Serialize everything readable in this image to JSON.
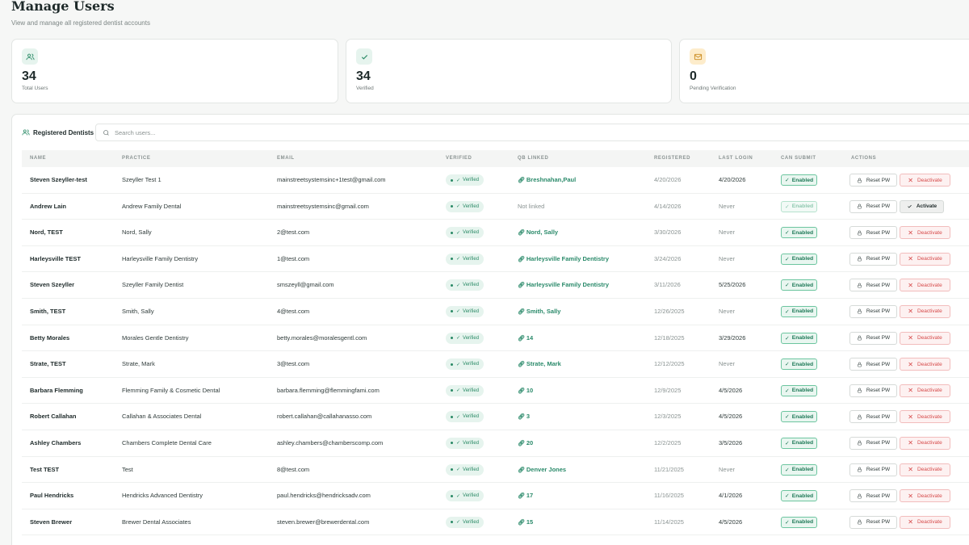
{
  "page": {
    "title": "Manage Users",
    "subtitle": "View and manage all registered dentist accounts"
  },
  "stats": [
    {
      "value": "34",
      "label": "Total Users",
      "icon": "users-icon",
      "color": "#e6f4ee"
    },
    {
      "value": "34",
      "label": "Verified",
      "icon": "check-icon",
      "color": "#e6f4ee"
    },
    {
      "value": "0",
      "label": "Pending Verification",
      "icon": "mail-icon",
      "color": "#fdeccb"
    }
  ],
  "panel": {
    "title": "Registered Dentists",
    "search_placeholder": "Search users..."
  },
  "columns": [
    "Name",
    "Practice",
    "Email",
    "Verified",
    "QB Linked",
    "Registered",
    "Last Login",
    "Can Submit",
    "Actions"
  ],
  "labels": {
    "verified": "Verified",
    "enabled": "Enabled",
    "reset": "Reset PW",
    "deactivate": "Deactivate",
    "activate": "Activate"
  },
  "users": [
    {
      "name": "Steven Szeyller-test",
      "practice": "Szeyller Test 1",
      "email": "mainstreetsystemsinc+1test@gmail.com",
      "qb": "Breshnahan,Paul",
      "linked": true,
      "registered": "4/20/2026",
      "last_login": "4/20/2026",
      "active": true
    },
    {
      "name": "Andrew Lain",
      "practice": "Andrew Family Dental",
      "email": "mainstreetsystemsinc@gmail.com",
      "qb": "Not linked",
      "linked": false,
      "registered": "4/14/2026",
      "last_login": "Never",
      "active": false
    },
    {
      "name": "Nord, TEST",
      "practice": "Nord, Sally",
      "email": "2@test.com",
      "qb": "Nord, Sally",
      "linked": true,
      "registered": "3/30/2026",
      "last_login": "Never",
      "active": true
    },
    {
      "name": "Harleysville TEST",
      "practice": "Harleysville Family Dentistry",
      "email": "1@test.com",
      "qb": "Harleysville Family Dentistry",
      "linked": true,
      "registered": "3/24/2026",
      "last_login": "Never",
      "active": true
    },
    {
      "name": "Steven Szeyller",
      "practice": "Szeyller Family Dentist",
      "email": "smszeyll@gmail.com",
      "qb": "Harleysville Family Dentistry",
      "linked": true,
      "registered": "3/11/2026",
      "last_login": "5/25/2026",
      "active": true
    },
    {
      "name": "Smith, TEST",
      "practice": "Smith, Sally",
      "email": "4@test.com",
      "qb": "Smith, Sally",
      "linked": true,
      "registered": "12/26/2025",
      "last_login": "Never",
      "active": true
    },
    {
      "name": "Betty Morales",
      "practice": "Morales Gentle Dentistry",
      "email": "betty.morales@moralesgentl.com",
      "qb": "14",
      "linked": true,
      "registered": "12/18/2025",
      "last_login": "3/29/2026",
      "active": true
    },
    {
      "name": "Strate, TEST",
      "practice": "Strate, Mark",
      "email": "3@test.com",
      "qb": "Strate, Mark",
      "linked": true,
      "registered": "12/12/2025",
      "last_login": "Never",
      "active": true
    },
    {
      "name": "Barbara Flemming",
      "practice": "Flemming Family & Cosmetic Dental",
      "email": "barbara.flemming@flemmingfami.com",
      "qb": "10",
      "linked": true,
      "registered": "12/9/2025",
      "last_login": "4/5/2026",
      "active": true
    },
    {
      "name": "Robert Callahan",
      "practice": "Callahan & Associates Dental",
      "email": "robert.callahan@callahanasso.com",
      "qb": "3",
      "linked": true,
      "registered": "12/3/2025",
      "last_login": "4/5/2026",
      "active": true
    },
    {
      "name": "Ashley Chambers",
      "practice": "Chambers Complete Dental Care",
      "email": "ashley.chambers@chamberscomp.com",
      "qb": "20",
      "linked": true,
      "registered": "12/2/2025",
      "last_login": "3/5/2026",
      "active": true
    },
    {
      "name": "Test TEST",
      "practice": "Test",
      "email": "8@test.com",
      "qb": "Denver Jones",
      "linked": true,
      "registered": "11/21/2025",
      "last_login": "Never",
      "active": true
    },
    {
      "name": "Paul Hendricks",
      "practice": "Hendricks Advanced Dentistry",
      "email": "paul.hendricks@hendricksadv.com",
      "qb": "17",
      "linked": true,
      "registered": "11/16/2025",
      "last_login": "4/1/2026",
      "active": true
    },
    {
      "name": "Steven Brewer",
      "practice": "Brewer Dental Associates",
      "email": "steven.brewer@brewerdental.com",
      "qb": "15",
      "linked": true,
      "registered": "11/14/2025",
      "last_login": "4/5/2026",
      "active": true
    }
  ]
}
